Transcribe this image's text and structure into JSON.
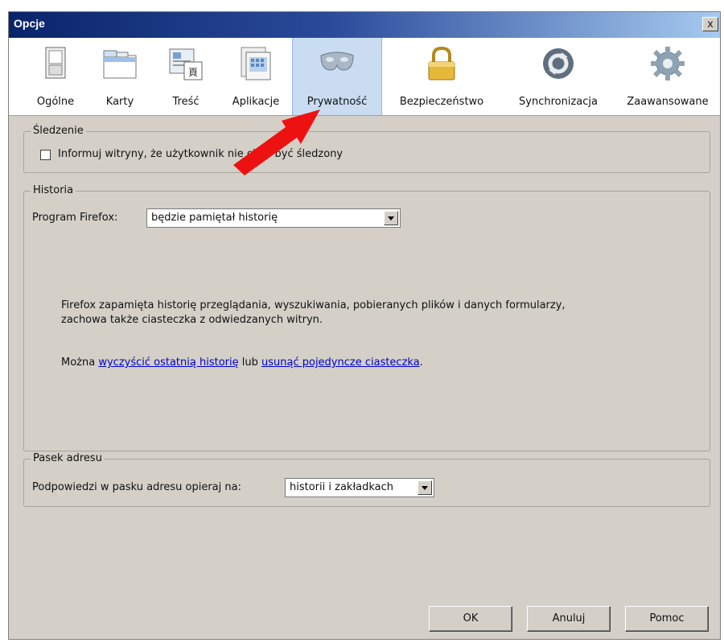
{
  "window": {
    "title": "Opcje",
    "close_label": "x"
  },
  "tabs": [
    {
      "id": "ogolne",
      "label": "Ogólne"
    },
    {
      "id": "karty",
      "label": "Karty"
    },
    {
      "id": "tresc",
      "label": "Treść"
    },
    {
      "id": "aplikacje",
      "label": "Aplikacje"
    },
    {
      "id": "prywatnosc",
      "label": "Prywatność",
      "active": true
    },
    {
      "id": "bezpieczenstwo",
      "label": "Bezpieczeństwo"
    },
    {
      "id": "synchronizacja",
      "label": "Synchronizacja"
    },
    {
      "id": "zaawansowane",
      "label": "Zaawansowane"
    }
  ],
  "tracking": {
    "legend": "Śledzenie",
    "checkbox_label": "Informuj witryny, że użytkownik nie chce być śledzony",
    "checked": false
  },
  "history": {
    "legend": "Historia",
    "program_label": "Program Firefox:",
    "select_value": "będzie pamiętał historię",
    "description_line1": "Firefox zapamięta historię przeglądania, wyszukiwania, pobieranych plików i danych formularzy,",
    "description_line2": "zachowa także ciasteczka z odwiedzanych witryn.",
    "can_prefix": "Można ",
    "link_clear": "wyczyścić ostatnią historię",
    "mid_text": " lub ",
    "link_remove_cookies": "usunąć pojedyncze ciasteczka",
    "suffix": "."
  },
  "address_bar": {
    "legend": "Pasek adresu",
    "label": "Podpowiedzi w pasku adresu opieraj na:",
    "select_value": "historii i zakładkach"
  },
  "buttons": {
    "ok": "OK",
    "cancel": "Anuluj",
    "help": "Pomoc"
  },
  "colors": {
    "titlebar": "#0a246a",
    "active_tab": "#c9dcf2",
    "annotation_arrow": "#ee1111",
    "link": "#0000cc"
  }
}
